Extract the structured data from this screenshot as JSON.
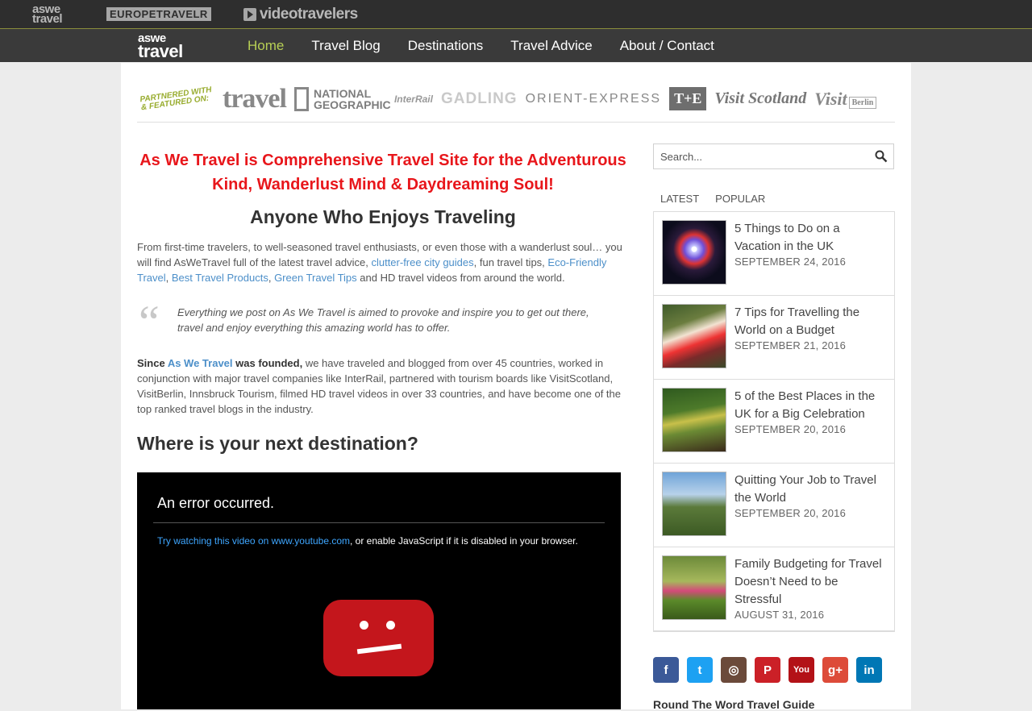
{
  "network": {
    "logos": [
      {
        "name": "aswe travel"
      },
      {
        "name": "EUROPETRAVELR"
      },
      {
        "name": "videotravelers"
      }
    ]
  },
  "nav": {
    "brand": {
      "line1": "aswe",
      "line2": "travel"
    },
    "items": [
      {
        "label": "Home",
        "active": true
      },
      {
        "label": "Travel Blog"
      },
      {
        "label": "Destinations"
      },
      {
        "label": "Travel Advice"
      },
      {
        "label": "About / Contact"
      }
    ]
  },
  "partners": {
    "badge": "PARTNERED WITH & FEATURED ON:",
    "logos": [
      "travel",
      "NATIONAL GEOGRAPHIC",
      "InterRail",
      "GADLING",
      "ORIENT-EXPRESS",
      "T+E",
      "Visit Scotland",
      "Visit",
      "Berlin"
    ]
  },
  "main": {
    "hero": "As We Travel is Comprehensive Travel Site for the Adventurous Kind, Wanderlust Mind & Daydreaming Soul!",
    "subhead": "Anyone Who Enjoys Traveling",
    "intro": {
      "t1": "From first-time travelers, to well-seasoned travel enthusiasts, or even those with a wanderlust soul… you will find AsWeTravel full of the latest travel advice, ",
      "link1": "clutter-free city guides",
      "t2": ", fun travel tips, ",
      "link2": "Eco-Friendly Travel",
      "t3": ", ",
      "link3": "Best Travel Products",
      "t4": ", ",
      "link4": "Green Travel Tips",
      "t5": " and HD travel videos from around the world."
    },
    "quote": "Everything we post on As We Travel is aimed to provoke and inspire you to get out there, travel and enjoy everything this amazing world has to offer.",
    "quote_mark": "“",
    "founded": {
      "b1": "Since ",
      "link": "As We Travel",
      "b2": " was founded,",
      "text": " we have traveled and blogged from over 45 countries, worked in conjunction with major travel companies like InterRail, partnered with tourism boards like VisitScotland, VisitBerlin, Innsbruck Tourism, filmed HD travel videos in over 33 countries, and have become one of the top ranked travel blogs in the industry."
    },
    "destination_heading": "Where is your next destination?",
    "video": {
      "error_title": "An error occurred.",
      "error_link": "Try watching this video on www.youtube.com",
      "error_rest": ", or enable JavaScript if it is disabled in your browser."
    }
  },
  "sidebar": {
    "search_placeholder": "Search...",
    "tabs": [
      "LATEST",
      "POPULAR"
    ],
    "posts": [
      {
        "title": "5 Things to Do on a Vacation in the UK",
        "date": "SEPTEMBER 24, 2016"
      },
      {
        "title": "7 Tips for Travelling the World on a Budget",
        "date": "SEPTEMBER 21, 2016"
      },
      {
        "title": "5 of the Best Places in the UK for a Big Celebration",
        "date": "SEPTEMBER 20, 2016"
      },
      {
        "title": "Quitting Your Job to Travel the World",
        "date": "SEPTEMBER 20, 2016"
      },
      {
        "title": "Family Budgeting for Travel Doesn’t Need to be Stressful",
        "date": "AUGUST 31, 2016"
      }
    ],
    "social": [
      {
        "icon": "facebook-icon",
        "glyph": "f",
        "color": "#3b5998"
      },
      {
        "icon": "twitter-icon",
        "glyph": "t",
        "color": "#1da1f2"
      },
      {
        "icon": "instagram-icon",
        "glyph": "◎",
        "color": "#6b4a3a"
      },
      {
        "icon": "pinterest-icon",
        "glyph": "P",
        "color": "#cb2027"
      },
      {
        "icon": "youtube-icon",
        "glyph": "You",
        "color": "#b31217"
      },
      {
        "icon": "googleplus-icon",
        "glyph": "g+",
        "color": "#dd4b39"
      },
      {
        "icon": "linkedin-icon",
        "glyph": "in",
        "color": "#0077b5"
      }
    ],
    "guide_heading": "Round The Word Travel Guide"
  },
  "colors": {
    "accent_green": "#b7cf55",
    "hero_red": "#e8161b",
    "link_blue": "#4c8fc9"
  }
}
